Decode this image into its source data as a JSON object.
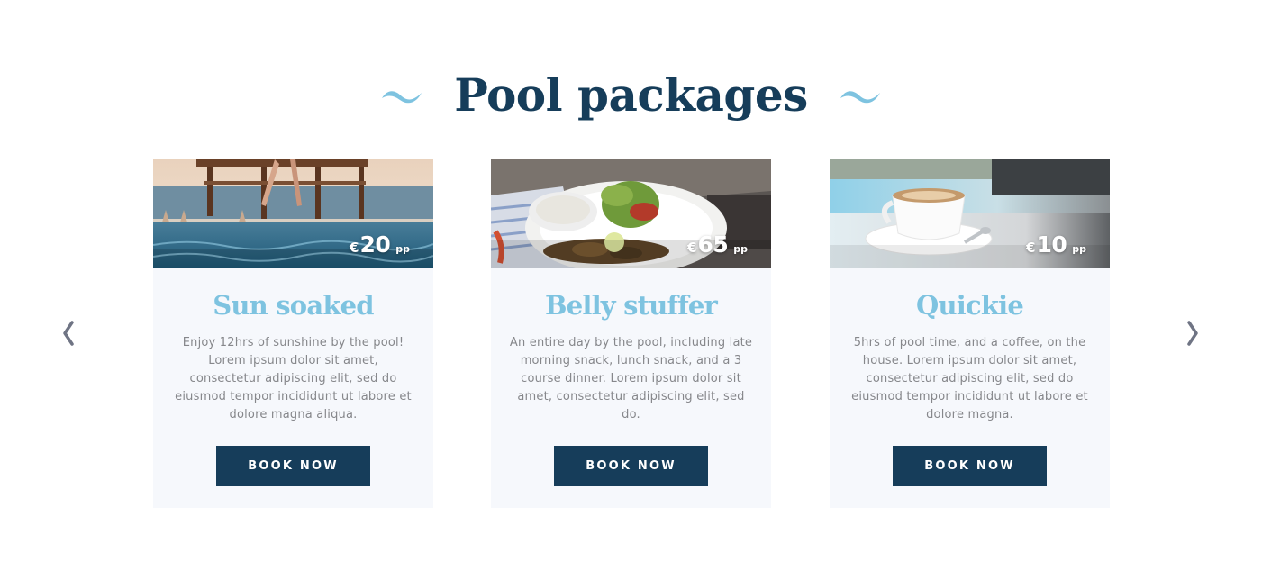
{
  "section": {
    "title": "Pool packages",
    "accent_color": "#7ec3e0",
    "title_color": "#163d5a"
  },
  "navigation": {
    "prev_icon": "chevron-left-icon",
    "next_icon": "chevron-right-icon"
  },
  "packages": [
    {
      "title": "Sun soaked",
      "currency": "€",
      "price": "20",
      "unit": "pp",
      "description": "Enjoy 12hrs of sunshine by the pool! Lorem ipsum dolor sit amet, consectetur adipiscing elit, sed do eiusmod tempor incididunt ut labore et dolore magna aliqua.",
      "button": "BOOK NOW"
    },
    {
      "title": "Belly stuffer",
      "currency": "€",
      "price": "65",
      "unit": "pp",
      "description": "An entire day by the pool, including late morning snack, lunch snack, and a 3 course dinner. Lorem ipsum dolor sit amet, consectetur adipiscing elit, sed do.",
      "button": "BOOK NOW"
    },
    {
      "title": "Quickie",
      "currency": "€",
      "price": "10",
      "unit": "pp",
      "description": "5hrs of pool time, and a coffee, on the house. Lorem ipsum dolor sit amet, consectetur adipiscing elit, sed do eiusmod tempor incididunt ut labore et dolore magna.",
      "button": "BOOK NOW"
    }
  ]
}
